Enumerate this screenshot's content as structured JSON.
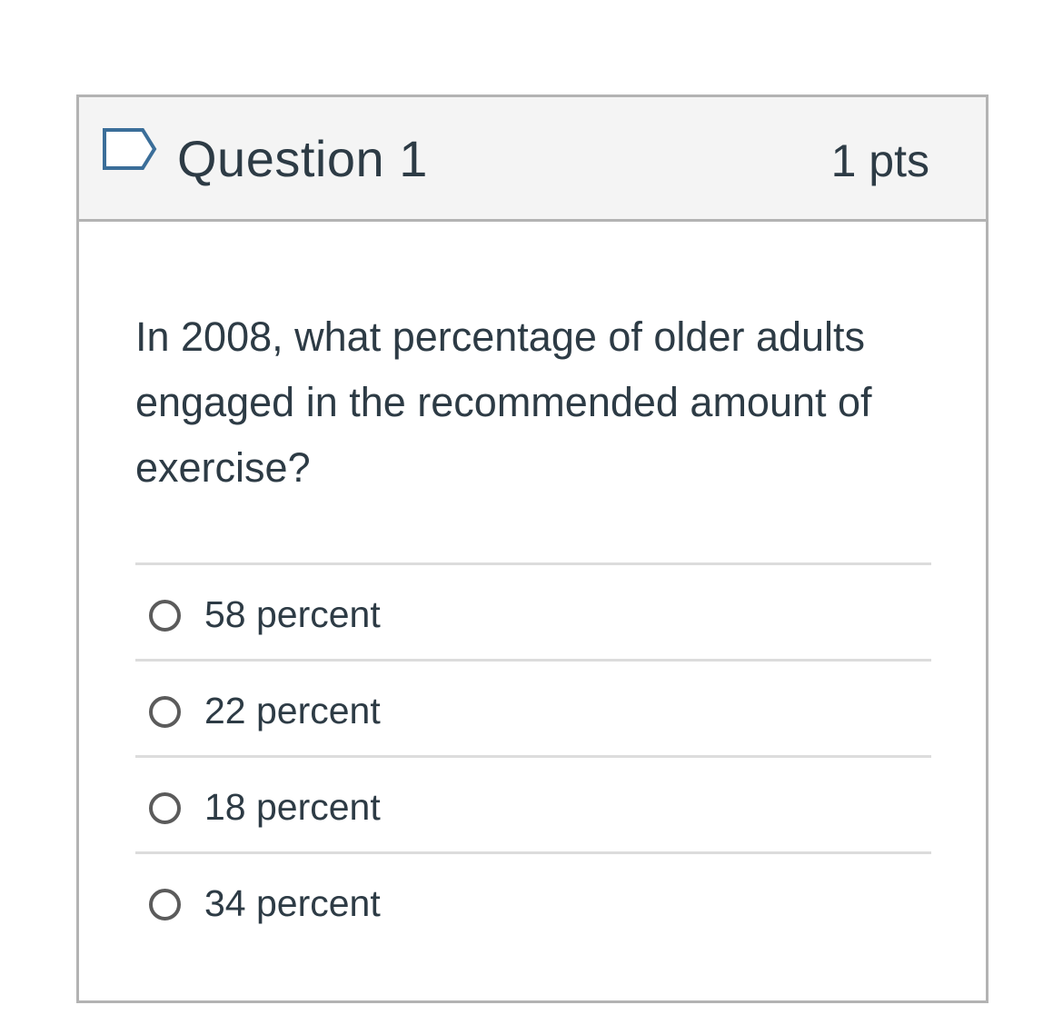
{
  "question": {
    "title": "Question 1",
    "points": "1 pts",
    "text": "In 2008, what percentage of older adults engaged in the recommended amount of exercise?",
    "flag_icon": "flag-outline-icon",
    "answers": [
      {
        "label": "58 percent",
        "selected": false
      },
      {
        "label": "22 percent",
        "selected": false
      },
      {
        "label": "18 percent",
        "selected": false
      },
      {
        "label": "34 percent",
        "selected": false
      }
    ]
  },
  "colors": {
    "text": "#2d3b45",
    "header_bg": "#f4f4f4",
    "border": "#b3b3b3",
    "flag": "#2d6aa0"
  }
}
